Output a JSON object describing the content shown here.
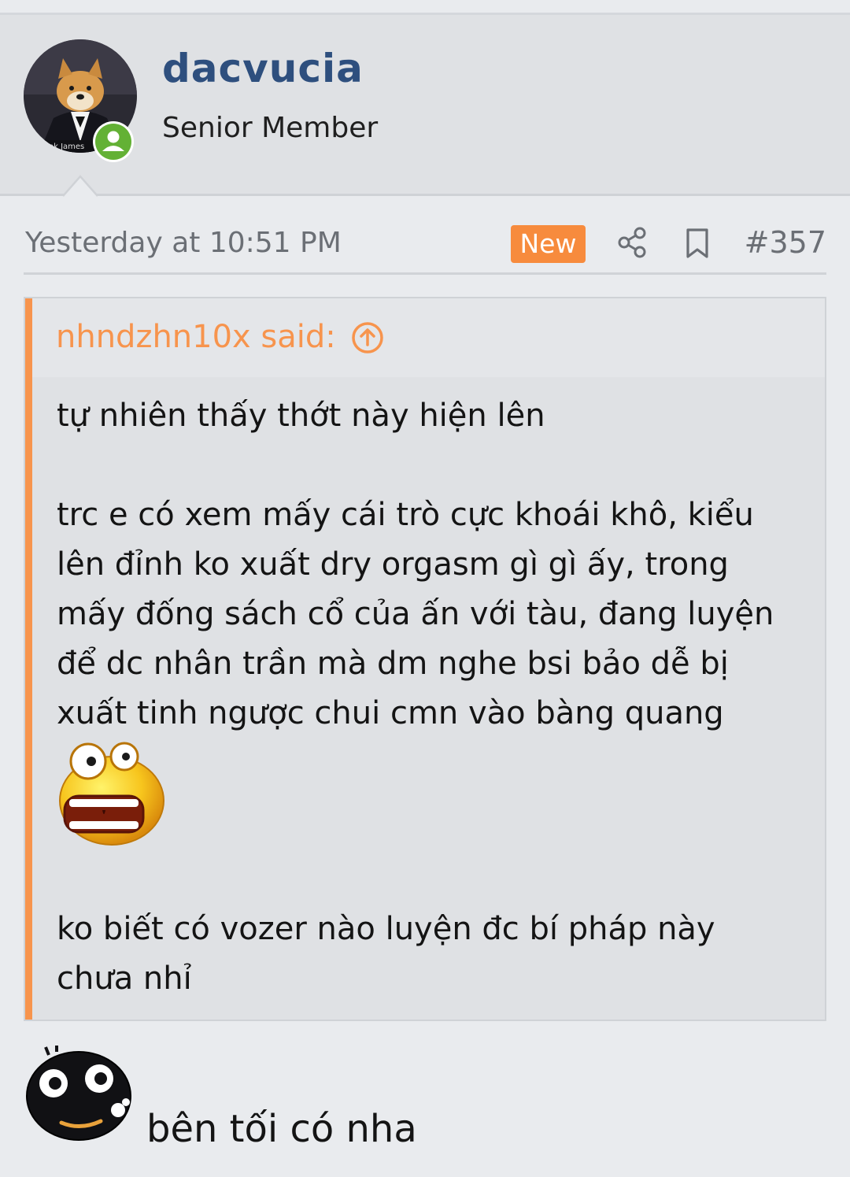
{
  "user": {
    "username": "dacvucia",
    "title": "Senior Member",
    "avatar_caption": "ok James"
  },
  "post": {
    "timestamp": "Yesterday at 10:51 PM",
    "badge": "New",
    "number": "#357",
    "icons": [
      "share-icon",
      "bookmark-icon"
    ]
  },
  "quote": {
    "author_label": "nhndzhn10x said:",
    "lines": [
      "tự nhiên thấy thớt này hiện lên",
      "trc e có xem mấy cái trò cực khoái khô, kiểu",
      "lên đỉnh ko xuất dry orgasm gì gì ấy, trong",
      "mấy đống sách cổ của ấn với tàu, đang luyện",
      "để dc nhân trần mà dm nghe bsi bảo dễ bị",
      "xuất tinh ngược chui cmn vào bàng quang",
      "ko biết có vozer nào luyện đc bí pháp này",
      "chưa nhỉ"
    ]
  },
  "reply": {
    "text": "bên tối có nha"
  },
  "colors": {
    "accent_orange": "#f7944d",
    "username_blue": "#2e4f7e",
    "online_green": "#63b135"
  }
}
